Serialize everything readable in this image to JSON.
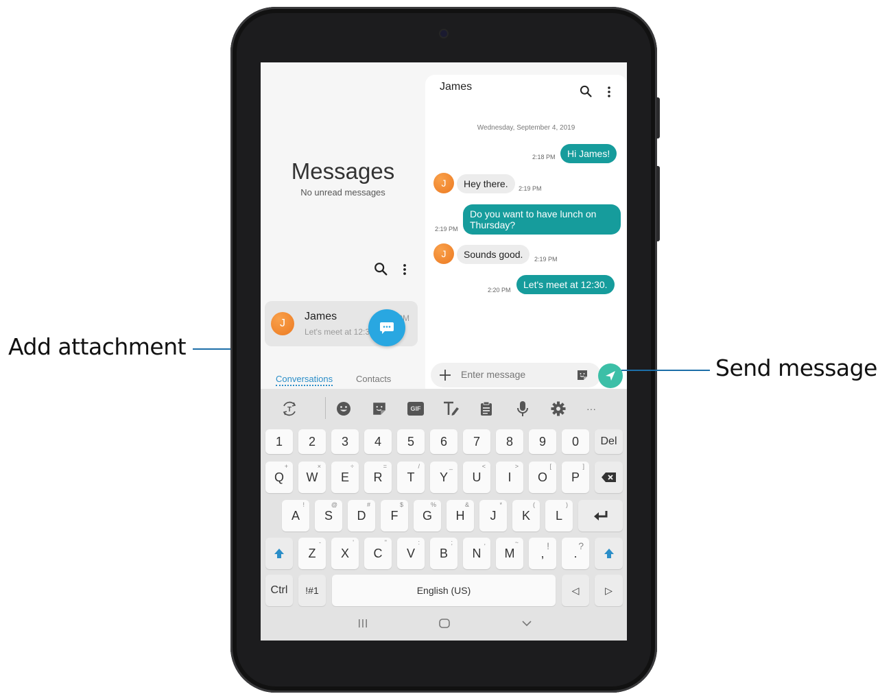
{
  "callouts": {
    "add_attachment": "Add attachment",
    "send_message": "Send message"
  },
  "left_panel": {
    "title": "Messages",
    "subtitle": "No unread messages",
    "conversation": {
      "avatar_letter": "J",
      "name": "James",
      "preview": "Let's meet at 12:30.",
      "time": "2:20 PM"
    },
    "tabs": [
      {
        "label": "Conversations",
        "active": true
      },
      {
        "label": "Contacts",
        "active": false
      }
    ]
  },
  "chat": {
    "contact_name": "James",
    "date": "Wednesday, September 4, 2019",
    "messages": [
      {
        "direction": "out",
        "text": "Hi James!",
        "time": "2:18 PM"
      },
      {
        "direction": "in",
        "avatar_letter": "J",
        "text": "Hey there.",
        "time": "2:19 PM"
      },
      {
        "direction": "out",
        "text_line1": "Do you want to have lunch on",
        "text_line2": "Thursday?",
        "time": "2:19 PM"
      },
      {
        "direction": "in",
        "avatar_letter": "J",
        "text": "Sounds good.",
        "time": "2:19 PM"
      },
      {
        "direction": "out",
        "text": "Let's meet at 12:30.",
        "time": "2:20 PM"
      }
    ],
    "composer_placeholder": "Enter message"
  },
  "keyboard": {
    "toolbar": [
      "translate-icon",
      "emoji-icon",
      "sticker-icon",
      "gif-icon",
      "text-style-icon",
      "clipboard-icon",
      "mic-icon",
      "settings-icon",
      "more-icon"
    ],
    "gif_label": "GIF",
    "more_label": "···",
    "number_row": [
      "1",
      "2",
      "3",
      "4",
      "5",
      "6",
      "7",
      "8",
      "9",
      "0"
    ],
    "del_label": "Del",
    "row_q": [
      {
        "k": "Q",
        "h": "+"
      },
      {
        "k": "W",
        "h": "×"
      },
      {
        "k": "E",
        "h": "÷"
      },
      {
        "k": "R",
        "h": "="
      },
      {
        "k": "T",
        "h": "/"
      },
      {
        "k": "Y",
        "h": "_"
      },
      {
        "k": "U",
        "h": "<"
      },
      {
        "k": "I",
        "h": ">"
      },
      {
        "k": "O",
        "h": "["
      },
      {
        "k": "P",
        "h": "]"
      }
    ],
    "row_a": [
      {
        "k": "A",
        "h": "!"
      },
      {
        "k": "S",
        "h": "@"
      },
      {
        "k": "D",
        "h": "#"
      },
      {
        "k": "F",
        "h": "$"
      },
      {
        "k": "G",
        "h": "%"
      },
      {
        "k": "H",
        "h": "&"
      },
      {
        "k": "J",
        "h": "*"
      },
      {
        "k": "K",
        "h": "("
      },
      {
        "k": "L",
        "h": ")"
      }
    ],
    "row_z": [
      {
        "k": "Z",
        "h": "-"
      },
      {
        "k": "X",
        "h": "'"
      },
      {
        "k": "C",
        "h": "\""
      },
      {
        "k": "V",
        "h": ":"
      },
      {
        "k": "B",
        "h": ";"
      },
      {
        "k": "N",
        "h": ","
      },
      {
        "k": "M",
        "h": "~"
      },
      {
        "k": ",",
        "h": "!"
      },
      {
        "k": ".",
        "h": "?"
      }
    ],
    "ctrl_label": "Ctrl",
    "sym_label": "!#1",
    "space_label": "English (US)",
    "left_arrow": "◁",
    "right_arrow": "▷"
  },
  "colors": {
    "accent_blue": "#29a7e1",
    "bubble_teal": "#169c9c",
    "send_green": "#3cbfa7",
    "avatar_orange": "#f28a30",
    "callout_line": "#1c6ea8"
  }
}
